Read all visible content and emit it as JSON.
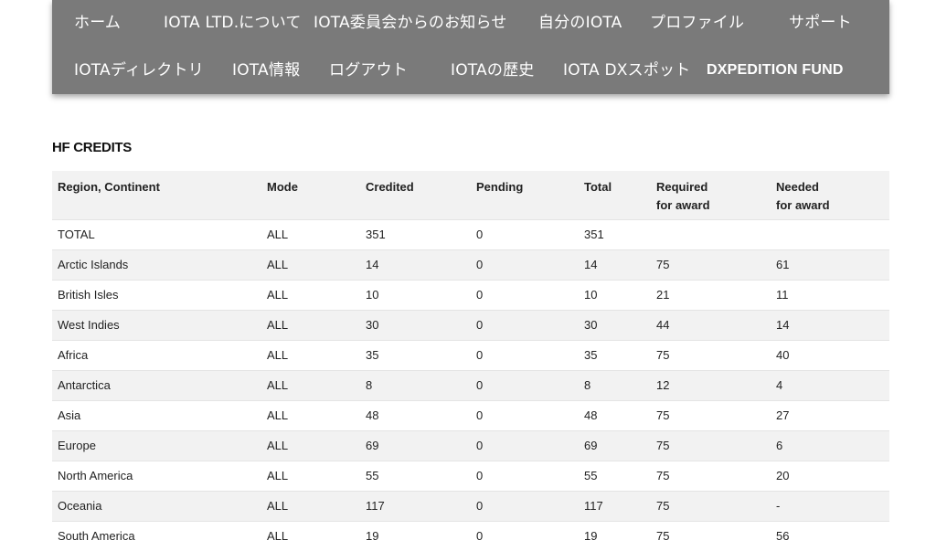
{
  "nav": {
    "row1": [
      {
        "label": "ホーム",
        "bold": false
      },
      {
        "label": "IOTA LTD.について",
        "bold": false
      },
      {
        "label": "IOTA委員会からのお知らせ",
        "bold": false
      },
      {
        "label": "自分のIOTA",
        "bold": false
      },
      {
        "label": "プロファイル",
        "bold": false
      },
      {
        "label": "サポート",
        "bold": false
      }
    ],
    "row2": [
      {
        "label": "IOTAディレクトリ",
        "bold": false
      },
      {
        "label": "IOTA情報",
        "bold": false
      },
      {
        "label": "ログアウト",
        "bold": false
      },
      {
        "label": "IOTAの歴史",
        "bold": false
      },
      {
        "label": "IOTA DXスポット",
        "bold": false
      },
      {
        "label": "DXPEDITION FUND",
        "bold": true
      }
    ]
  },
  "section_title": "HF CREDITS",
  "table": {
    "headers": [
      {
        "line1": "Region, Continent",
        "line2": ""
      },
      {
        "line1": "Mode",
        "line2": ""
      },
      {
        "line1": "Credited",
        "line2": ""
      },
      {
        "line1": "Pending",
        "line2": ""
      },
      {
        "line1": "Total",
        "line2": ""
      },
      {
        "line1": "Required",
        "line2": "for award"
      },
      {
        "line1": "Needed",
        "line2": "for award"
      }
    ],
    "rows": [
      [
        "TOTAL",
        "ALL",
        "351",
        "0",
        "351",
        "",
        ""
      ],
      [
        "Arctic Islands",
        "ALL",
        "14",
        "0",
        "14",
        "75",
        "61"
      ],
      [
        "British Isles",
        "ALL",
        "10",
        "0",
        "10",
        "21",
        "11"
      ],
      [
        "West Indies",
        "ALL",
        "30",
        "0",
        "30",
        "44",
        "14"
      ],
      [
        "Africa",
        "ALL",
        "35",
        "0",
        "35",
        "75",
        "40"
      ],
      [
        "Antarctica",
        "ALL",
        "8",
        "0",
        "8",
        "12",
        "4"
      ],
      [
        "Asia",
        "ALL",
        "48",
        "0",
        "48",
        "75",
        "27"
      ],
      [
        "Europe",
        "ALL",
        "69",
        "0",
        "69",
        "75",
        "6"
      ],
      [
        "North America",
        "ALL",
        "55",
        "0",
        "55",
        "75",
        "20"
      ],
      [
        "Oceania",
        "ALL",
        "117",
        "0",
        "117",
        "75",
        "-"
      ],
      [
        "South America",
        "ALL",
        "19",
        "0",
        "19",
        "75",
        "56"
      ]
    ]
  }
}
